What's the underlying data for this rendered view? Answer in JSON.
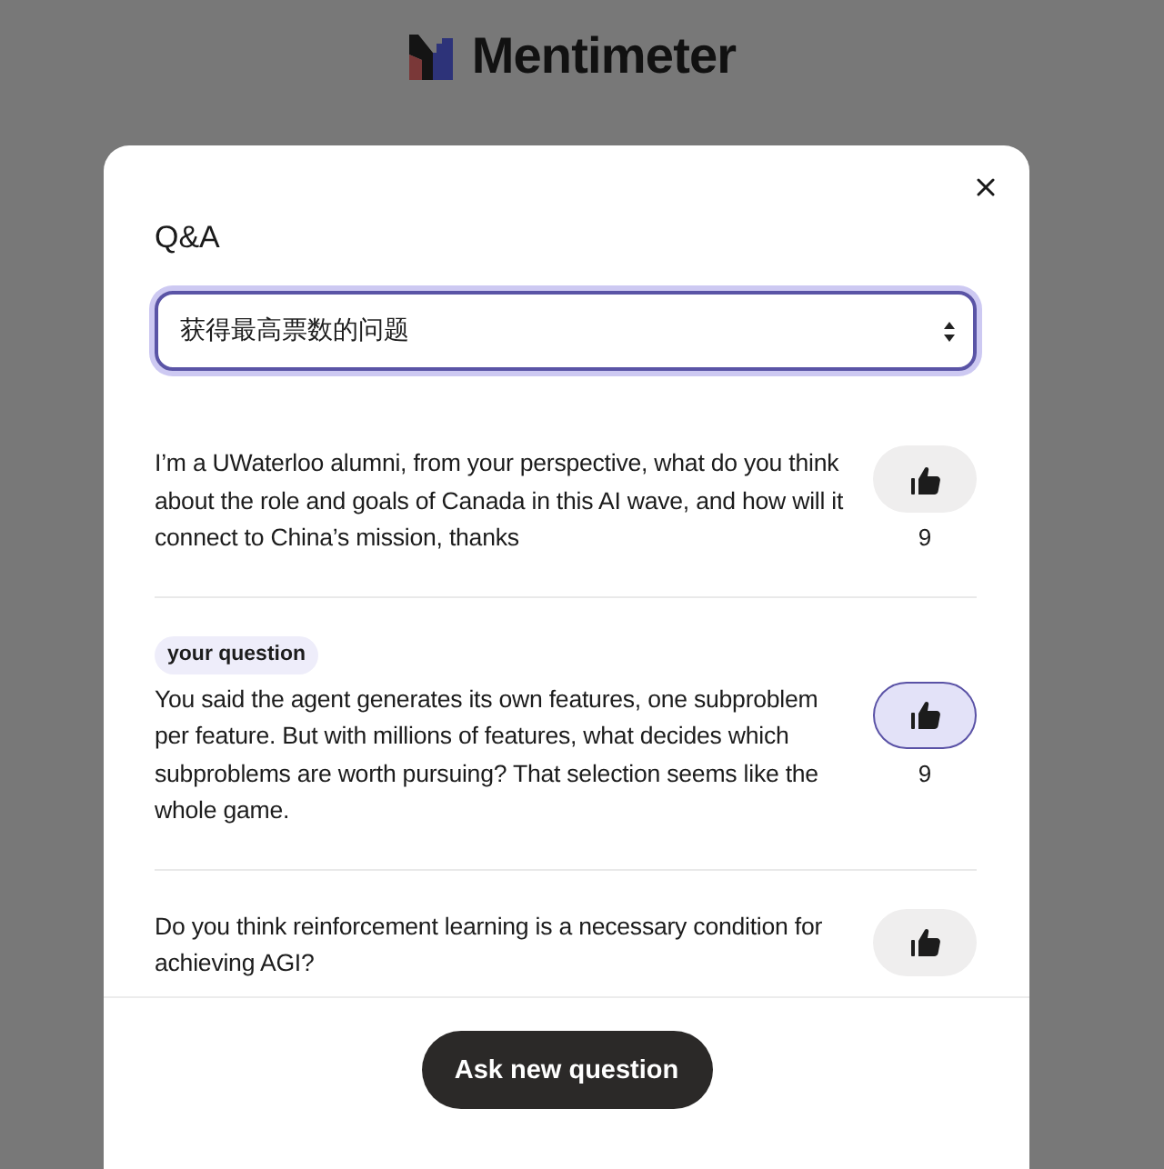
{
  "header": {
    "logo_text": "Mentimeter"
  },
  "dialog": {
    "title": "Q&A",
    "sort": {
      "value": "获得最高票数的问题"
    },
    "questions": [
      {
        "text": "I’m a UWaterloo alumni, from your perspective, what do you think about the role and goals of Canada in this AI wave, and how will it connect to China’s mission, thanks",
        "voted": false,
        "votes": "9"
      },
      {
        "tag": "your question",
        "text": "You said the agent generates its own features, one subproblem per feature. But with millions of features, what decides which subproblems are worth pursuing? That selection seems like the whole game.",
        "voted": true,
        "votes": "9"
      },
      {
        "text": "Do you think reinforcement learning is a necessary condition for achieving AGI?",
        "voted": false
      }
    ],
    "ask_button": "Ask new question"
  }
}
